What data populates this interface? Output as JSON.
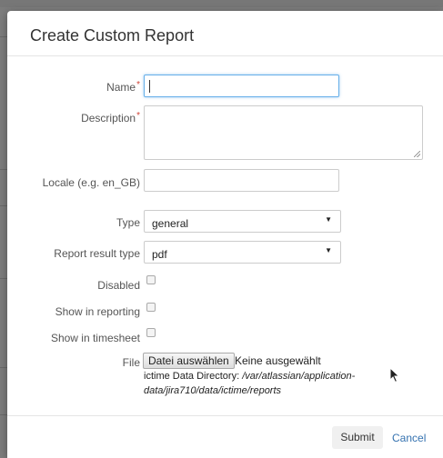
{
  "dialog": {
    "title": "Create Custom Report"
  },
  "fields": {
    "name": {
      "label": "Name",
      "required": "*",
      "value": ""
    },
    "description": {
      "label": "Description",
      "required": "*",
      "value": ""
    },
    "locale": {
      "label": "Locale (e.g. en_GB)",
      "value": ""
    },
    "type": {
      "label": "Type",
      "selected": "general"
    },
    "report_result_type": {
      "label": "Report result type",
      "selected": "pdf"
    },
    "disabled": {
      "label": "Disabled",
      "checked": false
    },
    "show_in_reporting": {
      "label": "Show in reporting",
      "checked": false
    },
    "show_in_timesheet": {
      "label": "Show in timesheet",
      "checked": false
    },
    "file": {
      "label": "File",
      "button_label": "Datei auswählen",
      "status": "Keine ausgewählt",
      "dir_label": "ictime Data Directory: ",
      "dir_path": "/var/atlassian/application-data/jira710/data/ictime/reports"
    }
  },
  "footer": {
    "submit_label": "Submit",
    "cancel_label": "Cancel"
  },
  "colors": {
    "required": "#d04437",
    "link": "#3572b0",
    "focus": "#66afe9"
  }
}
